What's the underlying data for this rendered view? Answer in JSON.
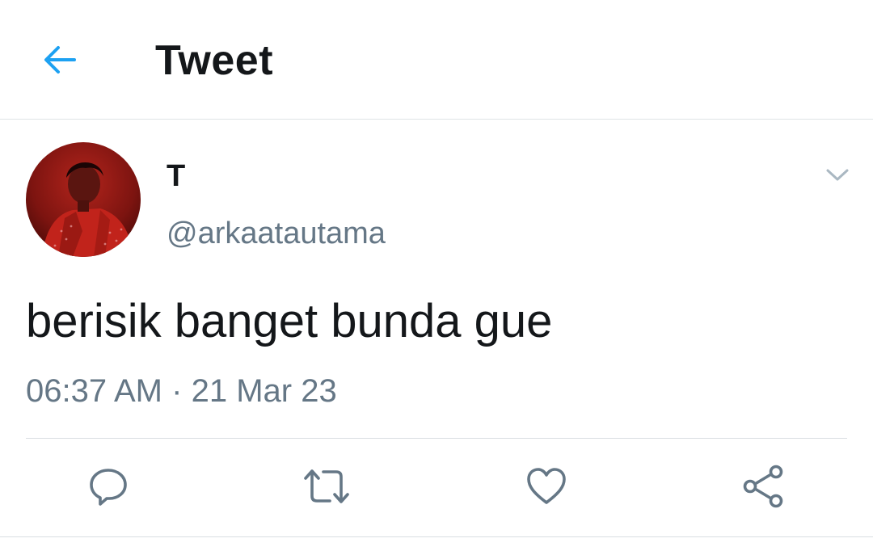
{
  "header": {
    "title": "Tweet",
    "back_icon": "arrow-left-icon"
  },
  "tweet": {
    "author": {
      "display_name": "T",
      "handle": "@arkaatautama",
      "avatar_icon": "profile-photo"
    },
    "text": "berisik banget bunda gue",
    "time": "06:37 AM",
    "separator": "·",
    "date": "21 Mar 23",
    "menu_icon": "chevron-down-icon"
  },
  "actions": [
    {
      "name": "reply",
      "icon": "reply-icon"
    },
    {
      "name": "retweet",
      "icon": "retweet-icon"
    },
    {
      "name": "like",
      "icon": "heart-icon"
    },
    {
      "name": "share",
      "icon": "share-icon"
    }
  ],
  "colors": {
    "accent": "#1da1f2",
    "text_primary": "#14171a",
    "text_secondary": "#657786",
    "icon_gray": "#657786",
    "divider": "#dfe3e6"
  }
}
